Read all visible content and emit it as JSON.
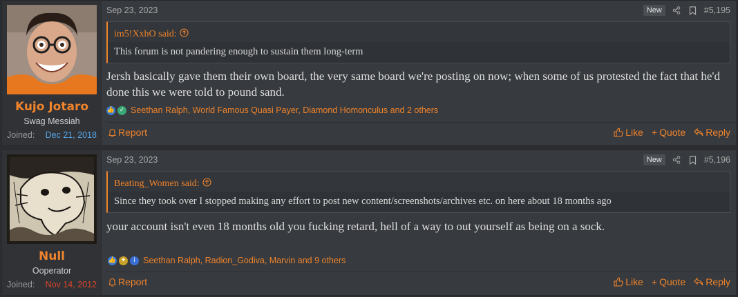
{
  "posts": [
    {
      "user": {
        "name": "Kujo Jotaro",
        "title": "Swag Messiah",
        "joined_label": "Joined:",
        "joined_date": "Dec 21, 2018",
        "joined_color": "#56a6e8",
        "avatar_icon": "avatar-photo-icon"
      },
      "date": "Sep 23, 2023",
      "badge": "New",
      "number": "#5,195",
      "quote": {
        "author": "im5!XxhO said:",
        "text": "This forum is not pandering enough to sustain them long-term"
      },
      "message": "Jersh basically gave them their own board, the very same board we're posting on now; when some of us protested the fact that he'd done this we were told to pound sand.",
      "reactions": "Seethan Ralph, World Famous Quasi Payer, Diamond Homonculus and 2 others",
      "report": "Report",
      "actions": [
        "Like",
        "Quote",
        "Reply"
      ]
    },
    {
      "user": {
        "name": "Null",
        "title": "Ooperator",
        "joined_label": "Joined:",
        "joined_date": "Nov 14, 2012",
        "joined_color": "#d9442a",
        "avatar_icon": "avatar-drawing-icon"
      },
      "date": "Sep 23, 2023",
      "badge": "New",
      "number": "#5,196",
      "quote": {
        "author": "Beating_Women said:",
        "text": "Since they took over I stopped making any effort to post new content/screenshots/archives etc. on here about 18 months ago"
      },
      "message": "your account isn't even 18 months old you fucking retard, hell of a way to out yourself as being on a sock.",
      "reactions": "Seethan Ralph, Radion_Godiva, Marvin and 9 others",
      "report": "Report",
      "actions": [
        "Like",
        "Quote",
        "Reply"
      ]
    }
  ],
  "colors": {
    "accent": "#f0842c",
    "background": "#373a3e"
  }
}
